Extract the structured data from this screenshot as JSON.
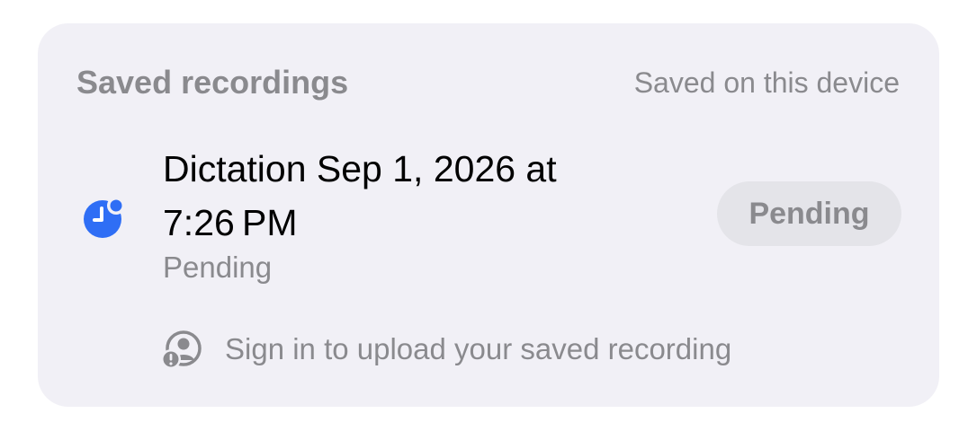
{
  "section": {
    "title": "Saved recordings",
    "subtitle": "Saved on this device"
  },
  "recording": {
    "title": "Dictation Sep 1, 2026 at 7:26 PM",
    "status": "Pending",
    "action_label": "Pending",
    "icon": "clock-pending-icon",
    "icon_color": "#2f6ef5"
  },
  "signin": {
    "label": "Sign in to upload your saved recording",
    "icon": "person-warning-icon"
  },
  "colors": {
    "card_background": "#f1f0f6",
    "secondary_text": "#8a8a8e",
    "pill_background": "#e4e4e9"
  }
}
